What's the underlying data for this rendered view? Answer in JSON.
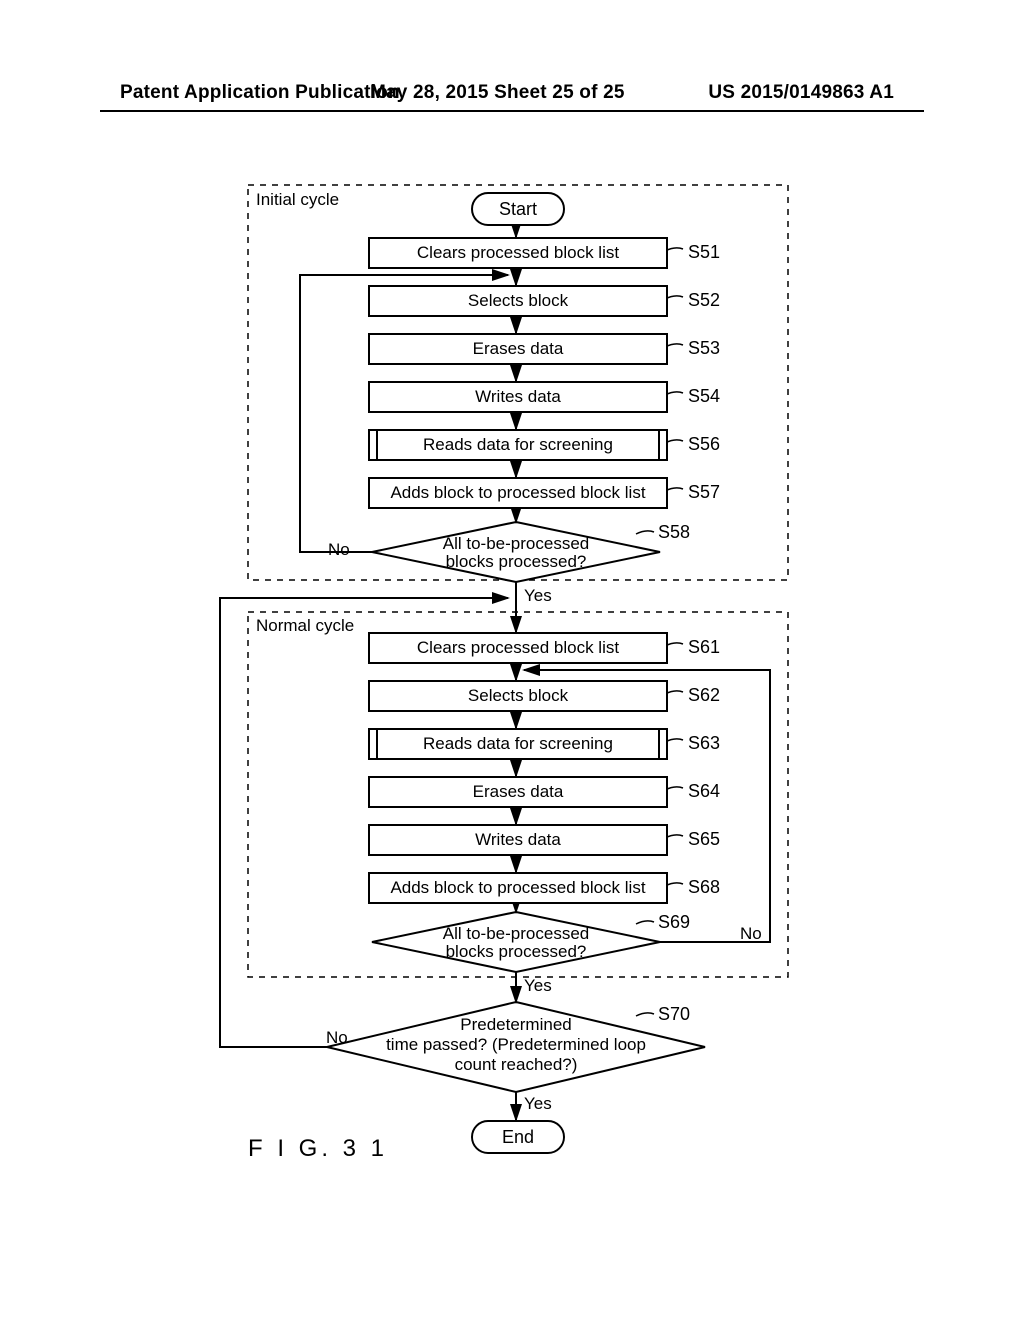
{
  "header": {
    "left": "Patent Application Publication",
    "middle": "May 28, 2015  Sheet 25 of 25",
    "right": "US 2015/0149863 A1"
  },
  "figure_label": "F I G. 3 1",
  "cycles": {
    "initial": "Initial cycle",
    "normal": "Normal cycle"
  },
  "nodes": {
    "start": "Start",
    "end": "End",
    "s51": "Clears processed block list",
    "s52": "Selects block",
    "s53": "Erases data",
    "s54": "Writes data",
    "s56": "Reads data for screening",
    "s57": "Adds block to processed block list",
    "s58_l1": "All to-be-processed",
    "s58_l2": "blocks processed?",
    "s61": "Clears processed block list",
    "s62": "Selects block",
    "s63": "Reads data for screening",
    "s64": "Erases data",
    "s65": "Writes data",
    "s68": "Adds block to processed block list",
    "s69_l1": "All to-be-processed",
    "s69_l2": "blocks processed?",
    "s70_l1": "Predetermined",
    "s70_l2": "time passed? (Predetermined loop",
    "s70_l3": "count reached?)"
  },
  "labels": {
    "s51": "S51",
    "s52": "S52",
    "s53": "S53",
    "s54": "S54",
    "s56": "S56",
    "s57": "S57",
    "s58": "S58",
    "s61": "S61",
    "s62": "S62",
    "s63": "S63",
    "s64": "S64",
    "s65": "S65",
    "s68": "S68",
    "s69": "S69",
    "s70": "S70"
  },
  "branches": {
    "yes": "Yes",
    "no": "No"
  }
}
